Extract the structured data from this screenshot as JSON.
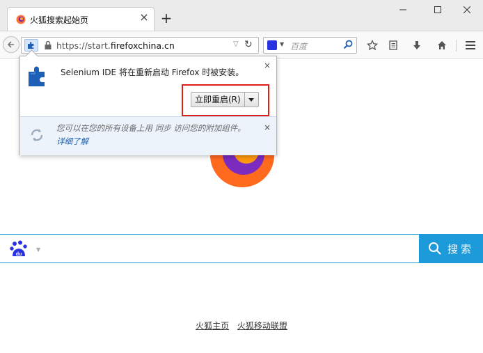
{
  "browser": {
    "tab": {
      "title": "火狐搜索起始页",
      "close": "×"
    },
    "new_tab": "+",
    "url": {
      "prefix": "https://start.",
      "domain": "firefoxchina.cn"
    },
    "search": {
      "placeholder": "百度"
    }
  },
  "addon_popup": {
    "message": "Selenium IDE 将在重新启动 Firefox 时被安装。",
    "restart_button": "立即重启(R)",
    "sync_message": "您可以在您的所有设备上用 同步 访问您的附加组件。",
    "sync_link": "详细了解",
    "close": "×",
    "highlight_color": "#e0201b"
  },
  "page": {
    "search_button": "搜索",
    "accent_color": "#1c9ad9",
    "footer_links": [
      "火狐主页",
      "火狐移动联盟"
    ]
  },
  "icons": [
    "firefox-icon",
    "back-arrow-icon",
    "puzzle-icon",
    "lock-icon",
    "reload-icon",
    "baidu-icon",
    "magnifier-icon",
    "star-icon",
    "reading-list-icon",
    "download-icon",
    "home-icon",
    "hamburger-menu-icon",
    "sync-icon"
  ]
}
